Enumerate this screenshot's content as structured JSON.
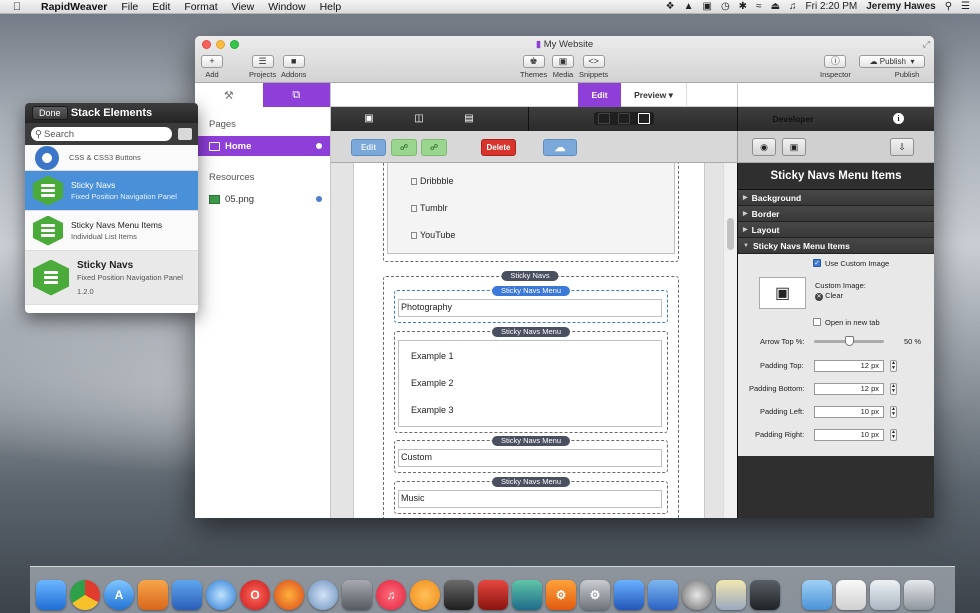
{
  "menubar": {
    "app_name": "RapidWeaver",
    "menus": [
      "File",
      "Edit",
      "Format",
      "View",
      "Window",
      "Help"
    ],
    "clock": "Fri 2:20 PM",
    "user": "Jeremy Hawes"
  },
  "stack_panel": {
    "title": "Stack Elements",
    "done_label": "Done",
    "search_placeholder": "Search",
    "items": [
      {
        "name": "",
        "desc": "CSS & CSS3 Buttons"
      },
      {
        "name": "Sticky Navs",
        "desc": "Fixed Position Navigation Panel"
      },
      {
        "name": "Sticky Navs Menu Items",
        "desc": "Individual List Items"
      }
    ],
    "detail": {
      "name": "Sticky Navs",
      "desc": "Fixed Position Navigation Panel",
      "version": "1.2.0"
    }
  },
  "window": {
    "title": "My Website",
    "toolbar": {
      "add": "Add",
      "projects": "Projects",
      "addons": "Addons",
      "themes": "Themes",
      "media": "Media",
      "snippets": "Snippets",
      "inspector": "Inspector",
      "publish": "Publish",
      "publish_btn": "Publish"
    },
    "sidebar": {
      "pages_header": "Pages",
      "pages": [
        "Home"
      ],
      "resources_header": "Resources",
      "resources": [
        "05.png"
      ]
    },
    "mode": {
      "edit": "Edit",
      "preview": "Preview"
    },
    "edit_buttons": {
      "edit": "Edit",
      "delete": "Delete"
    },
    "canvas": {
      "social_items": [
        "Dribbble",
        "Tumblr",
        "YouTube"
      ],
      "sticky_navs_label": "Sticky Navs",
      "menu_label": "Sticky Navs Menu",
      "photography": "Photography",
      "examples": [
        "Example 1",
        "Example 2",
        "Example 3"
      ],
      "custom": "Custom",
      "music": "Music"
    },
    "inspector": {
      "developer": "Developer",
      "header": "Sticky Navs Menu Items",
      "sections": [
        "Background",
        "Border",
        "Layout",
        "Sticky Navs Menu Items"
      ],
      "use_custom_image": "Use Custom Image",
      "custom_image_label": "Custom Image:",
      "clear": "Clear",
      "open_new_tab": "Open in new tab",
      "arrow_top_label": "Arrow Top %:",
      "arrow_top_value": "50 %",
      "arrow_top_fraction": 0.5,
      "padding_top_label": "Padding Top:",
      "padding_top": "12 px",
      "padding_bottom_label": "Padding Bottom:",
      "padding_bottom": "12 px",
      "padding_left_label": "Padding Left:",
      "padding_left": "10 px",
      "padding_right_label": "Padding Right:",
      "padding_right": "10 px"
    }
  },
  "colors": {
    "accent": "#8e3fd8",
    "delete": "#d9342b",
    "selection": "#4a90d9"
  }
}
